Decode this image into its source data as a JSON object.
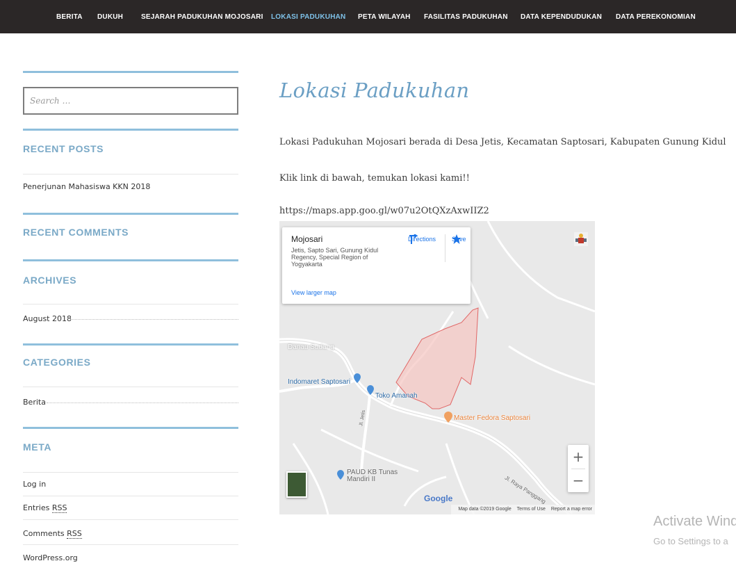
{
  "nav": {
    "items": [
      {
        "label": "BERITA"
      },
      {
        "label": "DUKUH"
      },
      {
        "label": "SEJARAH PADUKUHAN MOJOSARI"
      },
      {
        "label": "LOKASI PADUKUHAN"
      },
      {
        "label": "PETA WILAYAH"
      },
      {
        "label": "FASILITAS PADUKUHAN"
      },
      {
        "label": "DATA KEPENDUDUKAN"
      },
      {
        "label": "DATA PEREKONOMIAN"
      }
    ],
    "active_label": "LOKASI PADUKUHAN",
    "active_color": "#7ec1e8"
  },
  "sidebar": {
    "search": {
      "placeholder": "Search …"
    },
    "recent_posts": {
      "title": "RECENT POSTS",
      "items": [
        "Penerjunan Mahasiswa KKN 2018"
      ]
    },
    "recent_comments": {
      "title": "RECENT COMMENTS"
    },
    "archives": {
      "title": "ARCHIVES",
      "items": [
        "August 2018"
      ]
    },
    "categories": {
      "title": "CATEGORIES",
      "items": [
        "Berita"
      ]
    },
    "meta": {
      "title": "META",
      "login": "Log in",
      "entries_prefix": "Entries ",
      "comments_prefix": "Comments ",
      "rss": "RSS",
      "wordpress": "WordPress.org"
    },
    "accent_color": "#8fbfdc"
  },
  "main": {
    "title": "Lokasi Padukuhan",
    "paragraphs": [
      "Lokasi Padukuhan Mojosari berada di Desa Jetis, Kecamatan Saptosari, Kabupaten Gunung Kidul",
      "Klik link di bawah, temukan lokasi kami!!",
      "https://maps.app.goo.gl/w07u2OtQXzAxwIIZ2"
    ]
  },
  "map": {
    "place_name": "Mojosari",
    "address": "Jetis, Sapto Sari, Gunung Kidul Regency, Special Region of Yogyakarta",
    "directions_label": "Directions",
    "save_label": "Save",
    "view_larger": "View larger map",
    "labels": {
      "danau": "Danau Sudang",
      "indomaret": "Indomaret Saptosari",
      "toko": "Toko Amanah",
      "master": "Master Fedora Saptosari",
      "paud": "PAUD KB Tunas Mandiri II",
      "road": "Jl. Raya Panggang",
      "jetis": "Jl. Jetis"
    },
    "zoom_in": "+",
    "zoom_out": "−",
    "google": "Google",
    "attribution": {
      "data": "Map data ©2019 Google",
      "terms": "Terms of Use",
      "report": "Report a map error"
    },
    "highlight_color": "#e06666"
  },
  "watermark": {
    "line1": "Activate Wind",
    "line2": "Go to Settings to a"
  }
}
